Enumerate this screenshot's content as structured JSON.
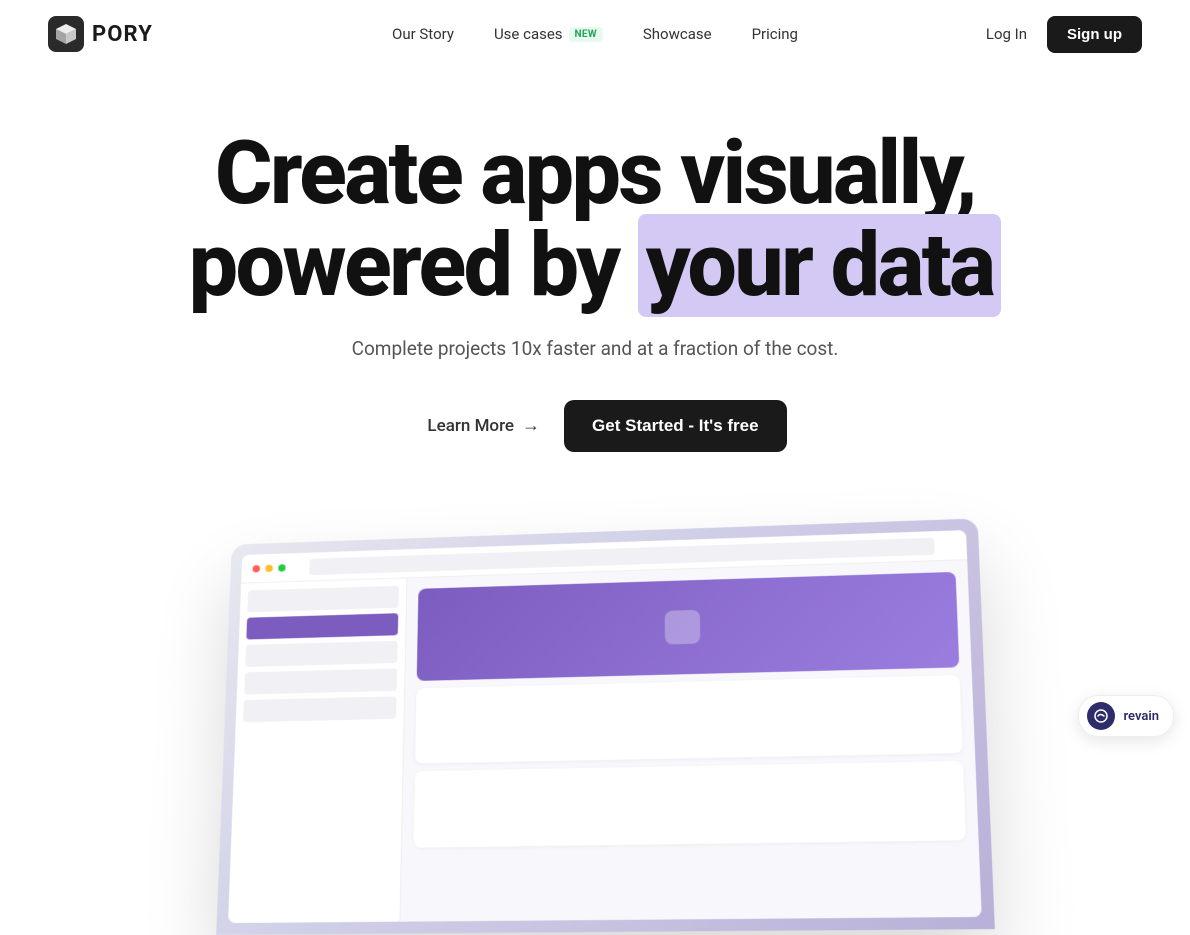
{
  "logo": {
    "text": "PORY"
  },
  "nav": {
    "links": [
      {
        "id": "our-story",
        "label": "Our Story",
        "badge": null
      },
      {
        "id": "use-cases",
        "label": "Use cases",
        "badge": "NEW"
      },
      {
        "id": "showcase",
        "label": "Showcase",
        "badge": null
      },
      {
        "id": "pricing",
        "label": "Pricing",
        "badge": null
      }
    ],
    "login_label": "Log In",
    "signup_label": "Sign up"
  },
  "hero": {
    "headline_part1": "Create apps visually,",
    "headline_part2": "powered by",
    "headline_highlight": "your data",
    "subheadline": "Complete projects 10x faster and at a fraction of the cost.",
    "cta_learn_more": "Learn More",
    "cta_get_started": "Get Started - It's free"
  },
  "revain": {
    "label": "revain"
  }
}
